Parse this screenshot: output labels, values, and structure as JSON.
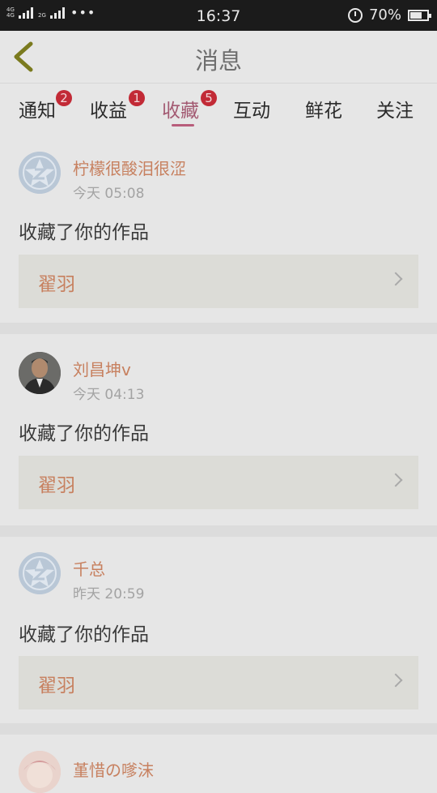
{
  "status_bar": {
    "sim1": "4G 4G",
    "sim2": "2G",
    "time": "16:37",
    "battery": "70%",
    "battery_level": 0.7
  },
  "header": {
    "title": "消息"
  },
  "tabs": [
    {
      "label": "通知",
      "badge": "2"
    },
    {
      "label": "收益",
      "badge": "1"
    },
    {
      "label": "收藏",
      "badge": "5",
      "active": true
    },
    {
      "label": "互动",
      "badge": ""
    },
    {
      "label": "鲜花",
      "badge": ""
    },
    {
      "label": "关注",
      "badge": ""
    }
  ],
  "items": [
    {
      "user": "柠檬很酸泪很涩",
      "time": "今天 05:08",
      "action": "收藏了你的作品",
      "work": "翟羽",
      "avatar": "default-avatar"
    },
    {
      "user": "刘昌坤v",
      "time": "今天 04:13",
      "action": "收藏了你的作品",
      "work": "翟羽",
      "avatar": "photo-avatar"
    },
    {
      "user": "千总",
      "time": "昨天 20:59",
      "action": "收藏了你的作品",
      "work": "翟羽",
      "avatar": "default-avatar"
    },
    {
      "user": "堇惜の嗲沫",
      "avatar": "illustration-avatar"
    }
  ]
}
